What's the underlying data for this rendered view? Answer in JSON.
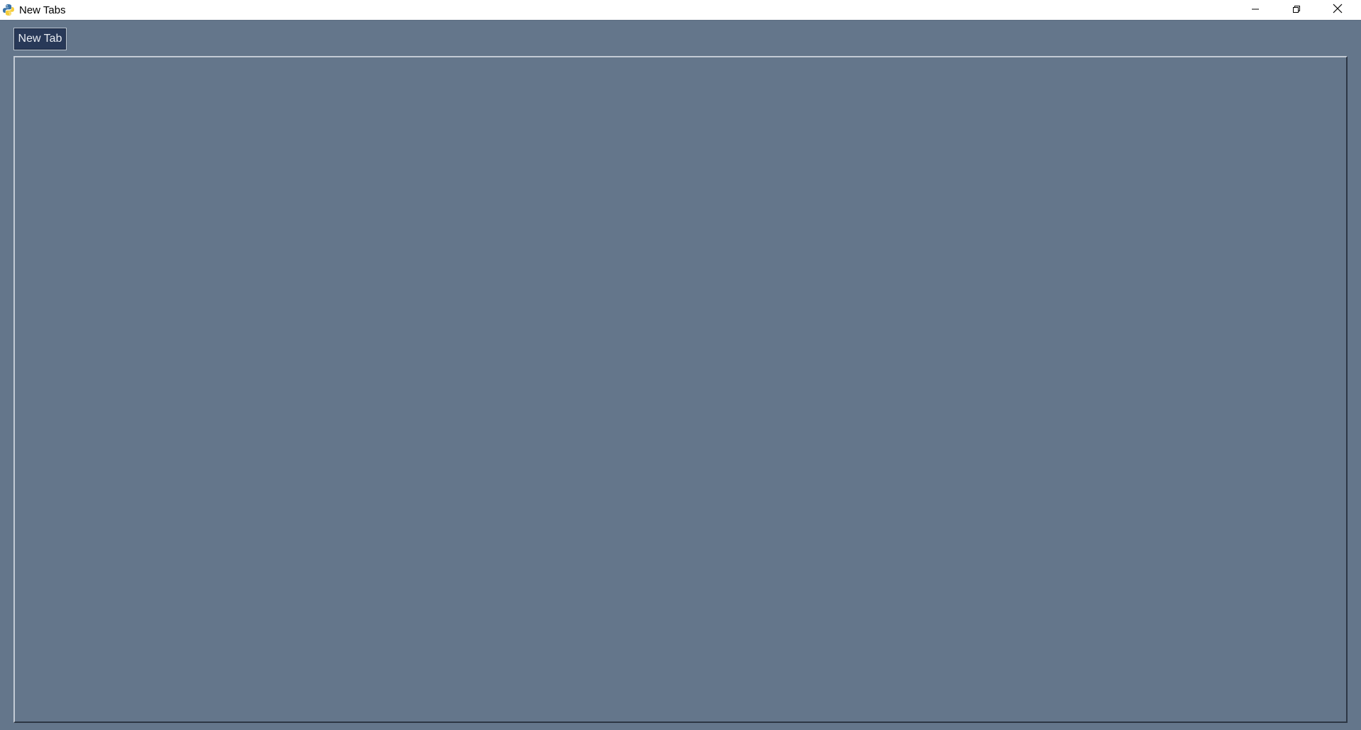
{
  "window": {
    "title": "New Tabs",
    "background_color": "#64768b",
    "controls": {
      "minimize_icon": "minimize-icon",
      "maximize_icon": "restore-icon",
      "close_icon": "close-icon"
    }
  },
  "toolbar": {
    "new_tab_label": "New Tab",
    "button_color": "#283958"
  },
  "app_icon": "python-icon"
}
